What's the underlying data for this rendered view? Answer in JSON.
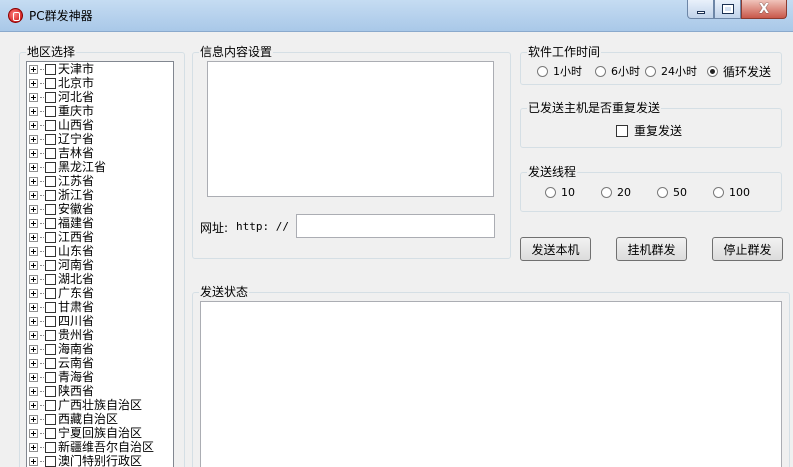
{
  "window": {
    "title": "PC群发神器",
    "close_glyph": "X"
  },
  "region": {
    "title": "地区选择",
    "items": [
      "天津市",
      "北京市",
      "河北省",
      "重庆市",
      "山西省",
      "辽宁省",
      "吉林省",
      "黑龙江省",
      "江苏省",
      "浙江省",
      "安徽省",
      "福建省",
      "江西省",
      "山东省",
      "河南省",
      "湖北省",
      "广东省",
      "甘肃省",
      "四川省",
      "贵州省",
      "海南省",
      "云南省",
      "青海省",
      "陕西省",
      "广西壮族自治区",
      "西藏自治区",
      "宁夏回族自治区",
      "新疆维吾尔自治区",
      "澳门特别行政区"
    ]
  },
  "message": {
    "title": "信息内容设置",
    "content": "",
    "url_label": "网址:",
    "url_prefix": "http: //",
    "url_value": ""
  },
  "work_time": {
    "title": "软件工作时间",
    "options": [
      "1小时",
      "6小时",
      "24小时",
      "循环发送"
    ],
    "selected": "循环发送"
  },
  "resend": {
    "title": "已发送主机是否重复发送",
    "checkbox_label": "重复发送",
    "checked": false
  },
  "threads": {
    "title": "发送线程",
    "options": [
      "10",
      "20",
      "50",
      "100"
    ],
    "selected": ""
  },
  "actions": {
    "send_local": "发送本机",
    "idle_send": "挂机群发",
    "stop_send": "停止群发"
  },
  "status": {
    "title": "发送状态",
    "content": ""
  }
}
